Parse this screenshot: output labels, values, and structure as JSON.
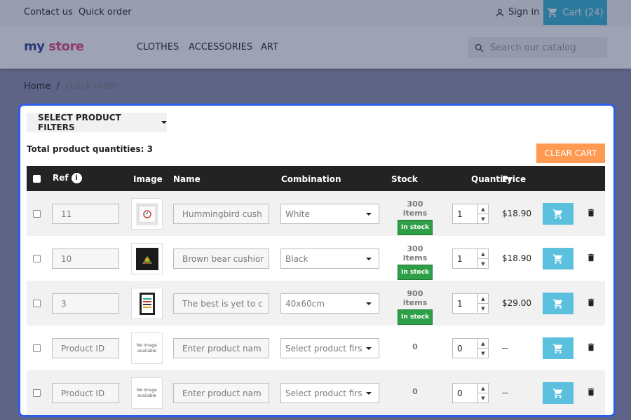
{
  "topbar": {
    "contact": "Contact us",
    "quick_order": "Quick order",
    "signin": "Sign in",
    "cart": "Cart (24)"
  },
  "header": {
    "logo_my": "my",
    "logo_store": "store",
    "nav": [
      "CLOTHES",
      "ACCESSORIES",
      "ART"
    ],
    "search_placeholder": "Search our catalog"
  },
  "breadcrumb": {
    "home": "Home",
    "separator": "/",
    "current": "Quick order"
  },
  "panel": {
    "filter_button": "SELECT PRODUCT FILTERS",
    "total_label": "Total product quantities: 3",
    "clear_cart": "CLEAR CART",
    "headers": {
      "ref": "Ref",
      "image": "Image",
      "name": "Name",
      "combination": "Combination",
      "stock": "Stock",
      "quantity": "Quantity",
      "price": "Price"
    },
    "rows": [
      {
        "ref": "11",
        "name": "Hummingbird cush",
        "combination": "White",
        "stock_items": "300 items",
        "stock_badge": "In stock",
        "qty": "1",
        "price": "$18.90",
        "image": "hummingbird-cushion"
      },
      {
        "ref": "10",
        "name": "Brown bear cushior",
        "combination": "Black",
        "stock_items": "300 items",
        "stock_badge": "In stock",
        "qty": "1",
        "price": "$18.90",
        "image": "brown-bear-cushion"
      },
      {
        "ref": "3",
        "name": "The best is yet to c",
        "combination": "40x60cm",
        "stock_items": "900 items",
        "stock_badge": "In stock",
        "qty": "1",
        "price": "$29.00",
        "image": "poster-frame"
      },
      {
        "ref": "Product ID",
        "name": "Enter product nam",
        "combination": "Select product firs",
        "stock_items": "0",
        "qty": "0",
        "price": "--",
        "image": "no-image",
        "no_image_text": "No image available"
      },
      {
        "ref": "Product ID",
        "name": "Enter product nam",
        "combination": "Select product firs",
        "stock_items": "0",
        "qty": "0",
        "price": "--",
        "image": "no-image",
        "no_image_text": "No image available"
      }
    ]
  },
  "colors": {
    "accent_border": "#2f5bea",
    "cart_button": "#5bc0de",
    "clear_cart": "#ff9a52",
    "in_stock": "#2e9e47",
    "header_dark": "#232323"
  }
}
